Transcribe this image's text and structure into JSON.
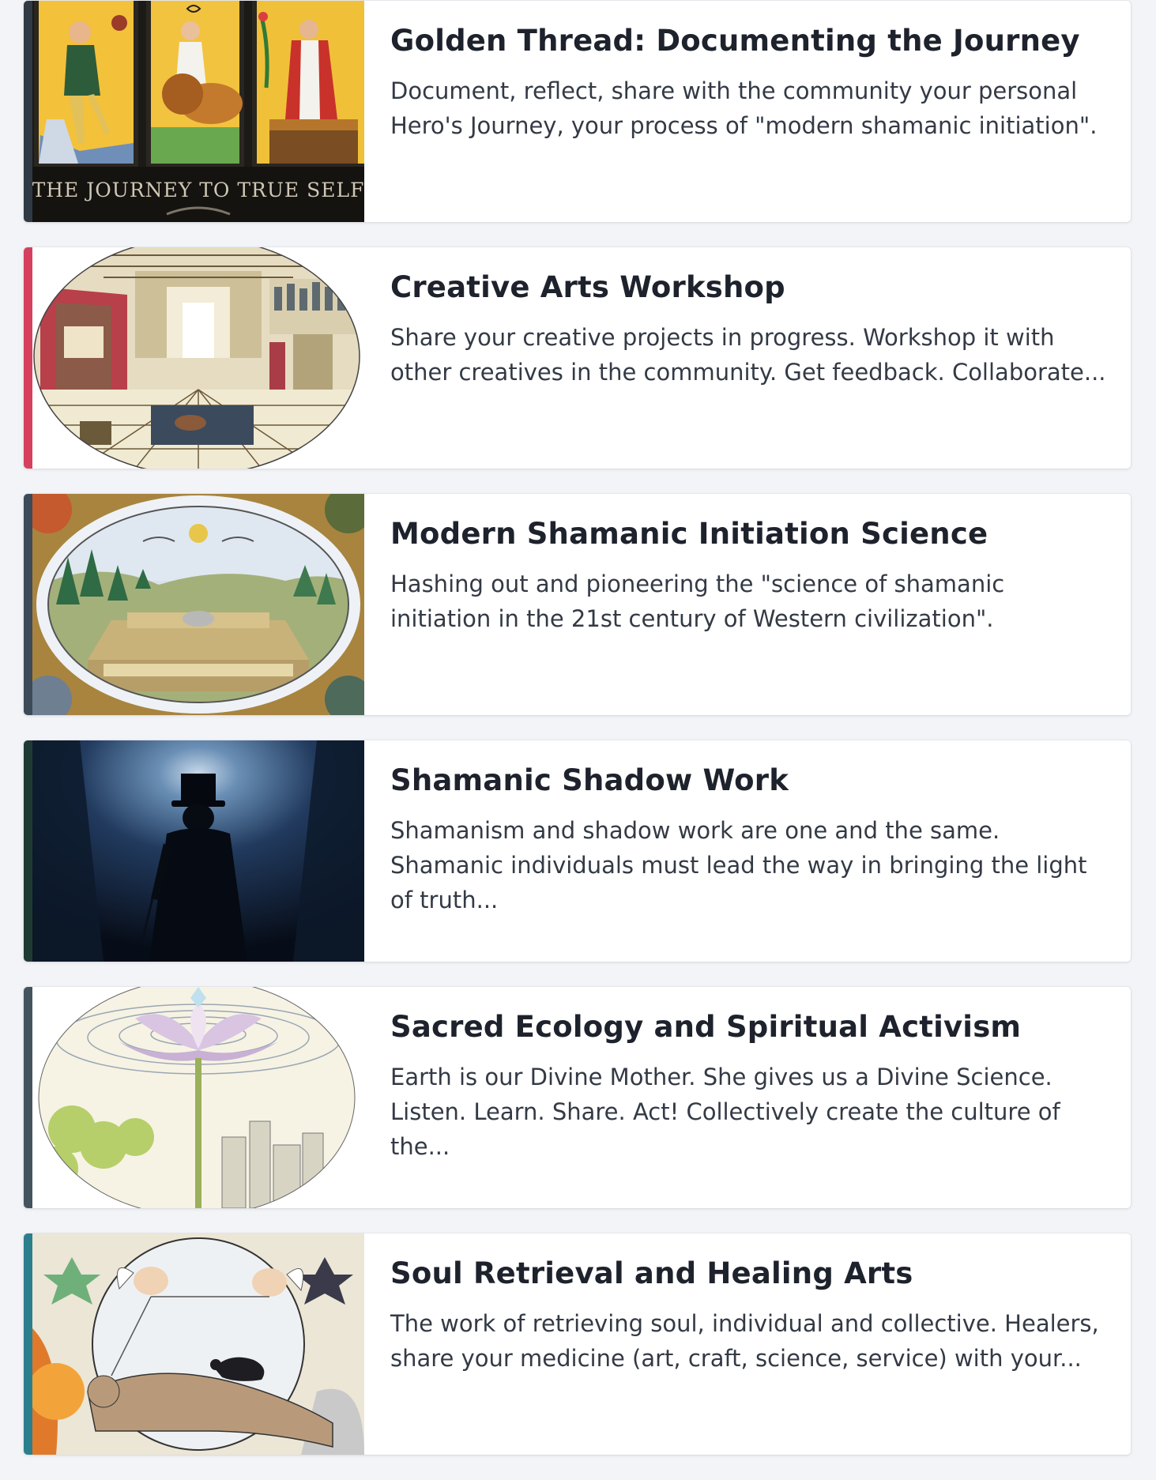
{
  "groups": [
    {
      "title": "Golden Thread: Documenting the Journey",
      "description": "Document, reflect, share with the community your personal Hero's Journey, your process of \"modern shamanic initiation\".",
      "accent_color": "#2f3a45",
      "thumbnail_icon": "tarot-cards-image",
      "thumbnail_caption": "THE JOURNEY TO TRUE SELF"
    },
    {
      "title": "Creative Arts Workshop",
      "description": "Share your creative projects in progress. Workshop it with other creatives in the community. Get feedback. Collaborate...",
      "accent_color": "#d6405e",
      "thumbnail_icon": "alchemist-laboratory-engraving-image"
    },
    {
      "title": "Modern Shamanic Initiation Science",
      "description": "Hashing out and pioneering the \"science of shamanic initiation in the 21st century of Western civilization\".",
      "accent_color": "#3d4a57",
      "thumbnail_icon": "alchemical-landscape-engraving-image"
    },
    {
      "title": "Shamanic Shadow Work",
      "description": "Shamanism and shadow work are one and the same. Shamanic individuals must lead the way in bringing the light of truth...",
      "accent_color": "#1f3a33",
      "thumbnail_icon": "shadow-figure-top-hat-image"
    },
    {
      "title": "Sacred Ecology and Spiritual Activism",
      "description": "Earth is our Divine Mother. She gives us a Divine Science. Listen. Learn. Share. Act! Collectively create the culture of the...",
      "accent_color": "#44545f",
      "thumbnail_icon": "sacred-flower-city-illustration-image"
    },
    {
      "title": "Soul Retrieval and Healing Arts",
      "description": "The work of retrieving soul, individual and collective. Healers, share your medicine (art, craft, science, service) with your...",
      "accent_color": "#2b7f8c",
      "thumbnail_icon": "alchemical-figure-raven-engraving-image"
    }
  ]
}
